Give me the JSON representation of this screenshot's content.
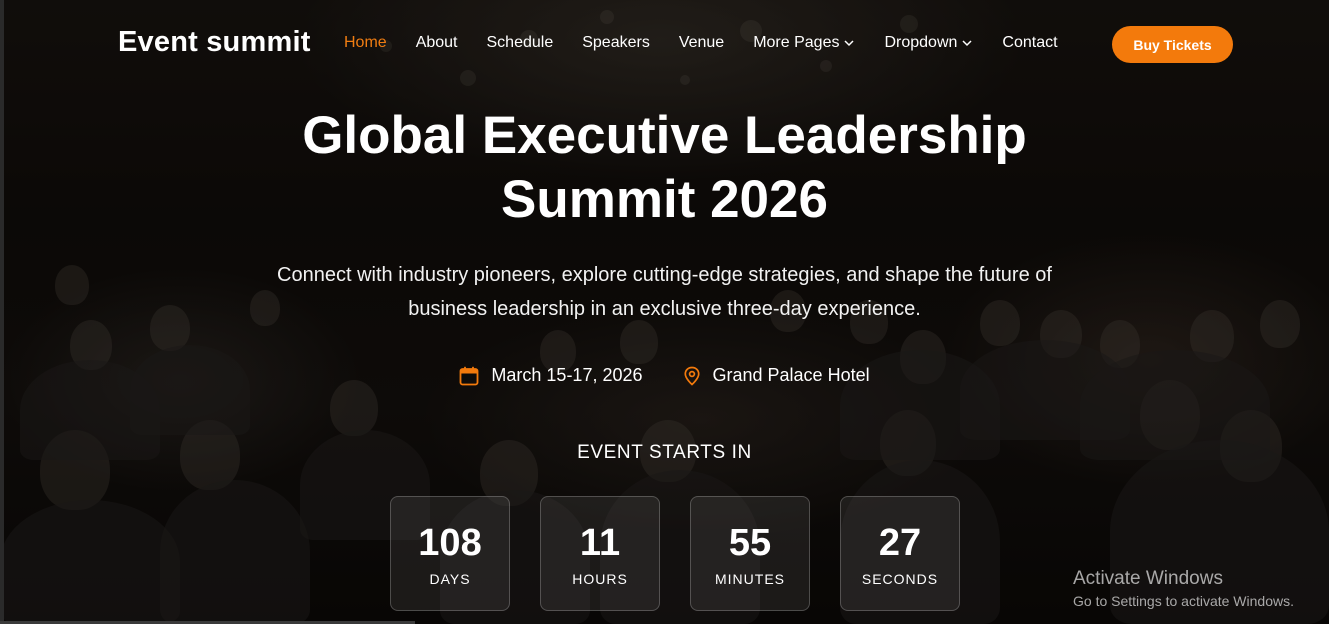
{
  "header": {
    "logo": "Event summit",
    "nav": [
      {
        "label": "Home",
        "active": true
      },
      {
        "label": "About"
      },
      {
        "label": "Schedule"
      },
      {
        "label": "Speakers"
      },
      {
        "label": "Venue"
      },
      {
        "label": "More Pages",
        "dropdown": true
      },
      {
        "label": "Dropdown",
        "dropdown": true
      },
      {
        "label": "Contact"
      }
    ],
    "cta": "Buy Tickets"
  },
  "hero": {
    "title": "Global Executive Leadership Summit 2026",
    "subtitle": "Connect with industry pioneers, explore cutting-edge strategies, and shape the future of business leadership in an exclusive three-day experience.",
    "date": "March 15-17, 2026",
    "location": "Grand Palace Hotel",
    "countdown_title": "EVENT STARTS IN",
    "countdown": [
      {
        "value": "108",
        "label": "DAYS"
      },
      {
        "value": "11",
        "label": "HOURS"
      },
      {
        "value": "55",
        "label": "MINUTES"
      },
      {
        "value": "27",
        "label": "SECONDS"
      }
    ]
  },
  "watermark": {
    "line1": "Activate Windows",
    "line2": "Go to Settings to activate Windows."
  },
  "colors": {
    "accent": "#f37a0c",
    "active_nav": "#f07d12"
  },
  "icons": {
    "date": "calendar-icon",
    "location": "map-pin-icon",
    "dropdown": "chevron-down-icon"
  }
}
